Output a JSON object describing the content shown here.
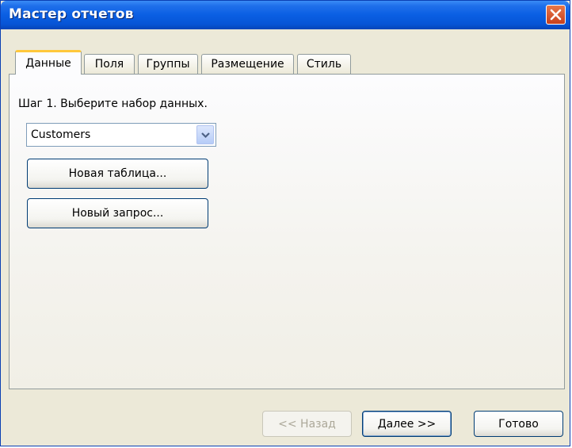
{
  "window": {
    "title": "Мастер отчетов"
  },
  "tabs": [
    {
      "label": "Данные",
      "active": true
    },
    {
      "label": "Поля",
      "active": false
    },
    {
      "label": "Группы",
      "active": false
    },
    {
      "label": "Размещение",
      "active": false
    },
    {
      "label": "Стиль",
      "active": false
    }
  ],
  "step": {
    "label": "Шаг 1. Выберите набор данных."
  },
  "dataset": {
    "selected": "Customers"
  },
  "actions": {
    "new_table": "Новая таблица...",
    "new_query": "Новый запрос..."
  },
  "footer": {
    "back": "<< Назад",
    "next": "Далее >>",
    "finish": "Готово"
  },
  "icons": {
    "close": "close-icon",
    "dropdown": "chevron-down-icon"
  },
  "colors": {
    "titlebar": "#0a5fe3",
    "active_tab_accent": "#ffc83c",
    "close_button": "#c8401d"
  }
}
